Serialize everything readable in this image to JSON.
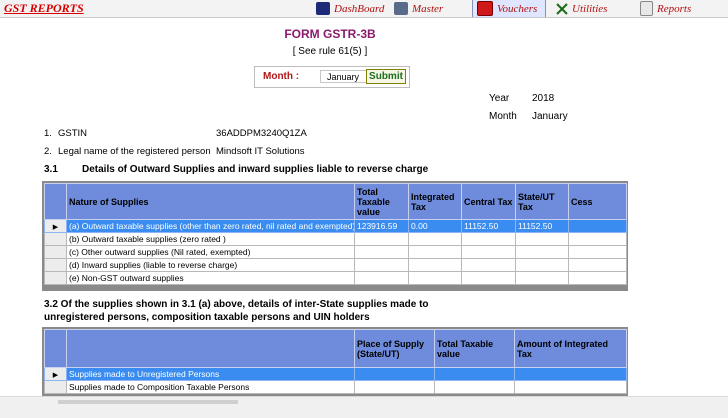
{
  "app": {
    "title": "GST REPORTS"
  },
  "menu": {
    "dashboard": "DashBoard",
    "master": "Master",
    "vouchers": "Vouchers",
    "utilities": "Utilities",
    "reports": "Reports"
  },
  "form": {
    "title": "FORM GSTR-3B",
    "rule": "[ See rule 61(5) ]"
  },
  "month_picker": {
    "label": "Month :",
    "selected": "January",
    "submit": "Submit"
  },
  "period": {
    "year_label": "Year",
    "year_value": "2018",
    "month_label": "Month",
    "month_value": "January"
  },
  "details": {
    "gstin_no": "1.",
    "gstin_label": "GSTIN",
    "gstin_value": "36ADDPM3240Q1ZA",
    "name_no": "2.",
    "name_label": "Legal name of the registered person",
    "name_value": "Mindsoft IT Solutions"
  },
  "section31": {
    "number": "3.1",
    "title": "Details of Outward Supplies and inward supplies liable to reverse charge",
    "columns": [
      "Nature of Supplies",
      "Total Taxable value",
      "Integrated Tax",
      "Central Tax",
      "State/UT Tax",
      "Cess"
    ],
    "rows": [
      [
        "(a) Outward taxable  supplies  (other than zero rated, nil rated and exempted)",
        "123916.59",
        "0.00",
        "11152.50",
        "11152.50",
        ""
      ],
      [
        "(b) Outward taxable  supplies  (zero rated )",
        "",
        "",
        "",
        "",
        ""
      ],
      [
        "(c) Other outward supplies (Nil rated, exempted)",
        "",
        "",
        "",
        "",
        ""
      ],
      [
        "(d) Inward supplies (liable to reverse charge)",
        "",
        "",
        "",
        "",
        ""
      ],
      [
        "(e) Non-GST outward supplies",
        "",
        "",
        "",
        "",
        ""
      ]
    ]
  },
  "section32": {
    "title_line1": "3.2   Of the supplies shown in 3.1 (a)  above, details of inter-State supplies made to",
    "title_line2": "unregistered persons, composition taxable persons and UIN holders",
    "columns": [
      "",
      "Place of Supply (State/UT)",
      "Total Taxable value",
      "Amount of Integrated Tax"
    ],
    "rows": [
      [
        "Supplies made to Unregistered Persons",
        "",
        "",
        ""
      ],
      [
        "Supplies made to Composition Taxable Persons",
        "",
        "",
        ""
      ]
    ]
  }
}
